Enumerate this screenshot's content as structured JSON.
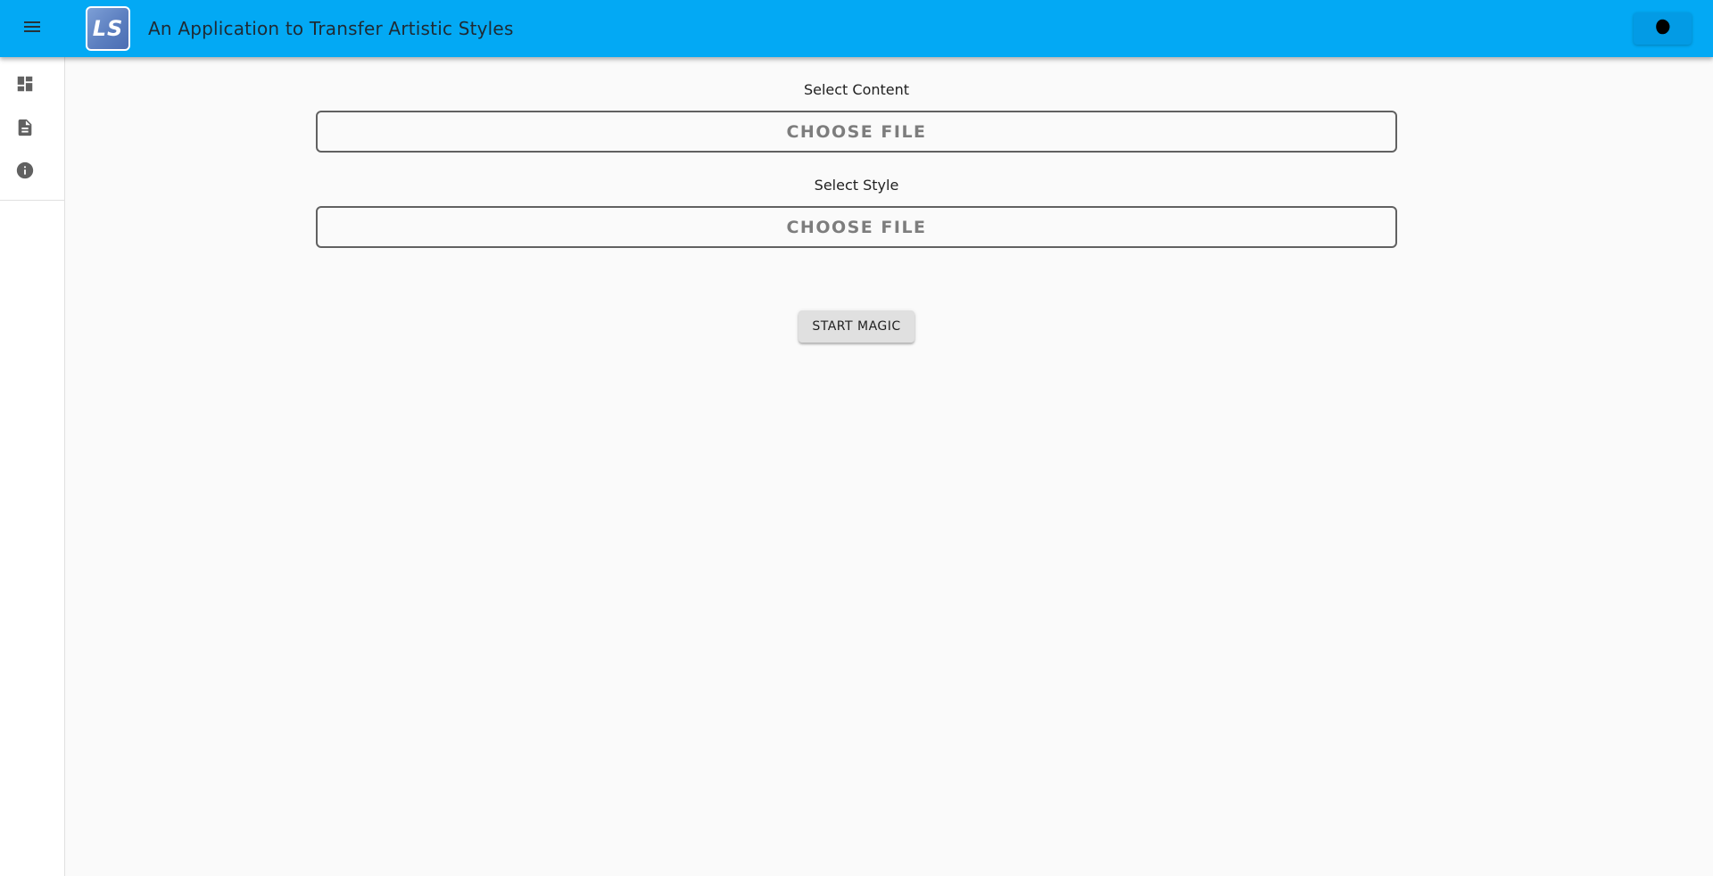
{
  "header": {
    "menu_icon": "menu-icon",
    "logo_text": "LS",
    "title": "An Application to Transfer Artistic Styles",
    "theme_icon": "dark-mode-icon",
    "background_color": "#03a9f4"
  },
  "sidebar": {
    "items": [
      {
        "icon": "dashboard-icon"
      },
      {
        "icon": "document-icon"
      },
      {
        "icon": "info-icon"
      }
    ]
  },
  "form": {
    "content": {
      "label": "Select Content",
      "button": "CHOOSE FILE"
    },
    "style": {
      "label": "Select Style",
      "button": "CHOOSE FILE"
    },
    "submit": "START MAGIC"
  }
}
